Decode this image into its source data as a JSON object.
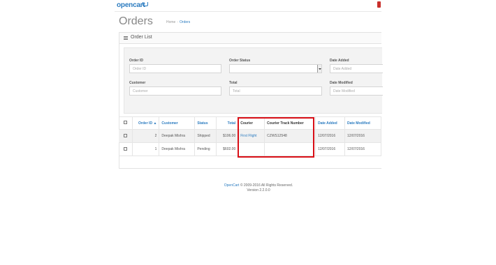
{
  "header": {
    "logo": "opencart"
  },
  "page": {
    "title": "Orders",
    "breadcrumb": [
      "Home",
      "Orders"
    ]
  },
  "panel": {
    "title": "Order List"
  },
  "filter": {
    "order_id": {
      "label": "Order ID",
      "placeholder": "Order ID"
    },
    "order_status": {
      "label": "Order Status",
      "value": ""
    },
    "date_added": {
      "label": "Date Added",
      "placeholder": "Date Added"
    },
    "customer": {
      "label": "Customer",
      "placeholder": "Customer"
    },
    "total": {
      "label": "Total",
      "placeholder": "Total"
    },
    "date_modified": {
      "label": "Date Modified",
      "placeholder": "Date Modified"
    }
  },
  "table": {
    "columns": [
      "Order ID",
      "Customer",
      "Status",
      "Total",
      "Courier",
      "Courier Track Number",
      "Date Added",
      "Date Modified"
    ],
    "rows": [
      {
        "order_id": "2",
        "customer": "Deepak Mishra",
        "status": "Shipped",
        "total": "$106.00",
        "courier": "First Flight",
        "track": "CZWS12548",
        "date_added": "12/07/2016",
        "date_modified": "12/07/2016"
      },
      {
        "order_id": "1",
        "customer": "Deepak Mishra",
        "status": "Pending",
        "total": "$602.00",
        "courier": "",
        "track": "",
        "date_added": "12/07/2016",
        "date_modified": "12/07/2016"
      }
    ]
  },
  "footer": {
    "brand": "OpenCart",
    "copyright": " © 2009-2016 All Rights Reserved.",
    "version": "Version 2.2.0.0"
  },
  "colors": {
    "accent": "#2c7cc0",
    "highlight": "#d90f17"
  }
}
